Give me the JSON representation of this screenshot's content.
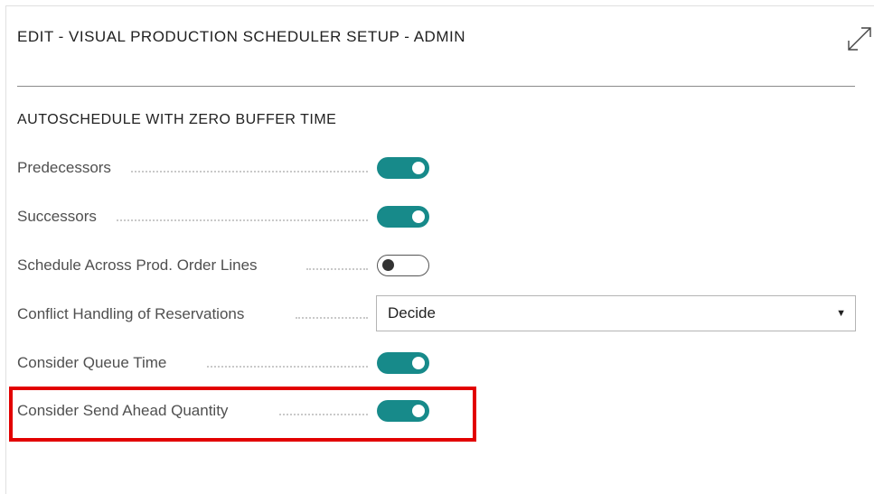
{
  "dialog": {
    "title": "EDIT - VISUAL PRODUCTION SCHEDULER SETUP - ADMIN",
    "expand_icon": "expand-diagonal-arrows-icon"
  },
  "section": {
    "title": "AUTOSCHEDULE WITH ZERO BUFFER TIME"
  },
  "fields": [
    {
      "label": "Predecessors",
      "type": "toggle",
      "value": true
    },
    {
      "label": "Successors",
      "type": "toggle",
      "value": true
    },
    {
      "label": "Schedule Across Prod. Order Lines",
      "type": "toggle",
      "value": false
    },
    {
      "label": "Conflict Handling of Reservations",
      "type": "select",
      "value": "Decide"
    },
    {
      "label": "Consider Queue Time",
      "type": "toggle",
      "value": true
    },
    {
      "label": "Consider Send Ahead Quantity",
      "type": "toggle",
      "value": true
    }
  ],
  "colors": {
    "toggle_on": "#178a8a",
    "highlight_border": "#e20000"
  }
}
